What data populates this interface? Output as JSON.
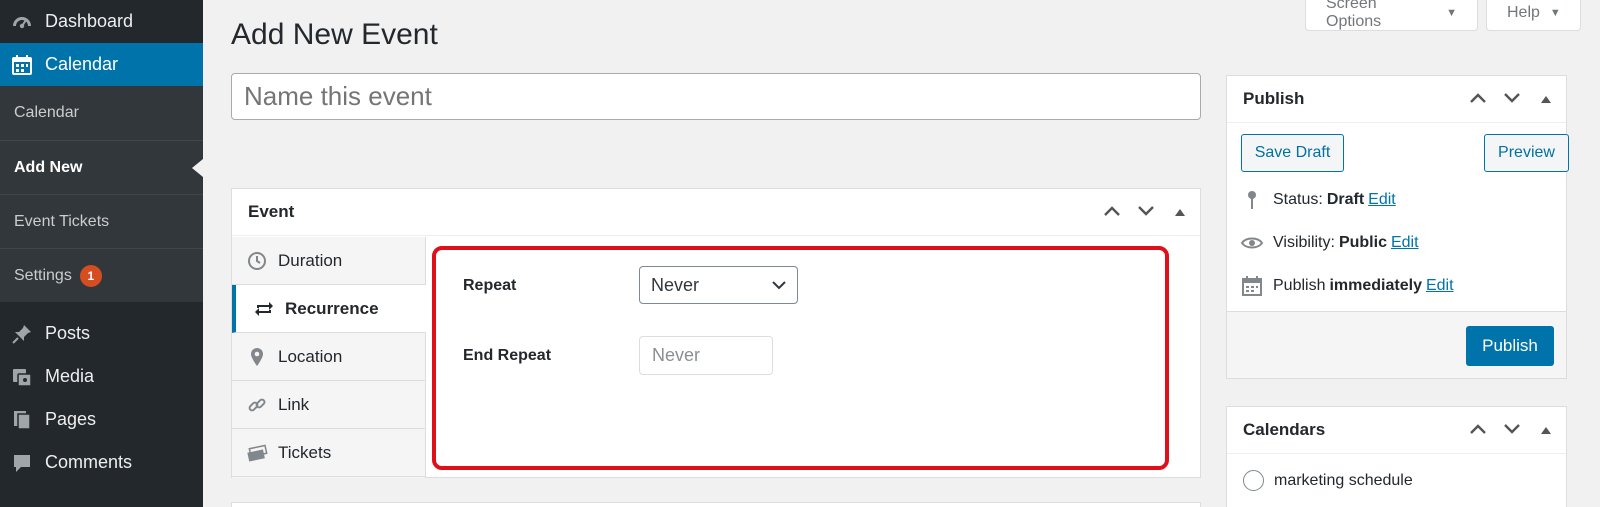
{
  "sidebar": {
    "top_items": [
      {
        "label": "Dashboard",
        "icon": "dashboard-icon"
      },
      {
        "label": "Calendar",
        "icon": "calendar-icon"
      }
    ],
    "submenu": [
      {
        "label": "Calendar"
      },
      {
        "label": "Add New"
      },
      {
        "label": "Event Tickets"
      },
      {
        "label": "Settings",
        "badge": "1"
      }
    ],
    "lower_items": [
      {
        "label": "Posts",
        "icon": "pin-icon"
      },
      {
        "label": "Media",
        "icon": "media-icon"
      },
      {
        "label": "Pages",
        "icon": "pages-icon"
      },
      {
        "label": "Comments",
        "icon": "comments-icon"
      }
    ]
  },
  "screen_meta": {
    "screen_options_label": "Screen Options",
    "help_label": "Help"
  },
  "page": {
    "title": "Add New Event",
    "name_placeholder": "Name this event"
  },
  "event_box": {
    "title": "Event",
    "tabs": [
      {
        "label": "Duration",
        "icon": "clock-icon"
      },
      {
        "label": "Recurrence",
        "icon": "repeat-icon"
      },
      {
        "label": "Location",
        "icon": "location-icon"
      },
      {
        "label": "Link",
        "icon": "link-icon"
      },
      {
        "label": "Tickets",
        "icon": "tickets-icon"
      }
    ],
    "active_tab": "Recurrence",
    "repeat_label": "Repeat",
    "repeat_value": "Never",
    "end_repeat_label": "End Repeat",
    "end_repeat_placeholder": "Never"
  },
  "publish_box": {
    "title": "Publish",
    "save_draft_label": "Save Draft",
    "preview_label": "Preview",
    "status_label": "Status:",
    "status_value": "Draft",
    "visibility_label": "Visibility:",
    "visibility_value": "Public",
    "publish_label": "Publish",
    "publish_value": "immediately",
    "edit_label": "Edit",
    "publish_button_label": "Publish"
  },
  "calendars_box": {
    "title": "Calendars",
    "items": [
      "marketing schedule"
    ]
  },
  "colors": {
    "sidebar_bg": "#23282d",
    "accent": "#0073aa",
    "highlight_border": "#e0101a",
    "badge": "#d54e21"
  }
}
